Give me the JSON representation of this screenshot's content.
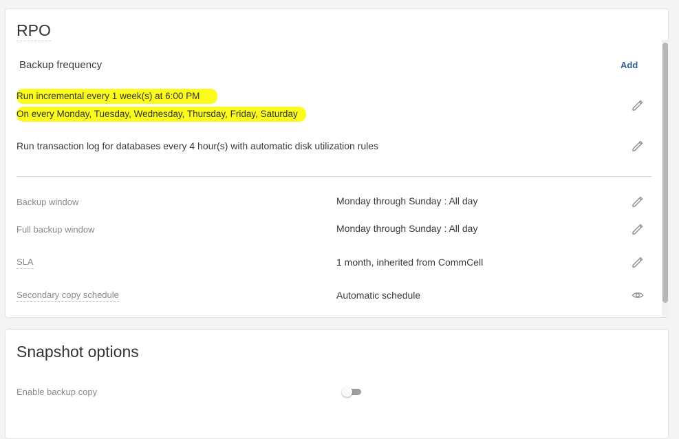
{
  "rpo": {
    "title": "RPO",
    "backup_frequency_label": "Backup frequency",
    "add_label": "Add",
    "schedule_line1": "Run incremental every 1 week(s) at 6:00 PM",
    "schedule_line2": "On every Monday, Tuesday, Wednesday, Thursday, Friday, Saturday",
    "transaction_log": "Run transaction log for databases every 4 hour(s) with automatic disk utilization rules",
    "rows": [
      {
        "label": "Backup window",
        "value": "Monday through Sunday : All day",
        "action_icon": "pencil-icon"
      },
      {
        "label": "Full backup window",
        "value": "Monday through Sunday : All day",
        "action_icon": "pencil-icon"
      },
      {
        "label": "SLA",
        "value": "1 month, inherited from CommCell",
        "action_icon": "pencil-icon"
      },
      {
        "label": "Secondary copy schedule",
        "value": "Automatic schedule",
        "action_icon": "eye-icon"
      }
    ],
    "highlight_color": "#fbfb1e",
    "link_color": "#2f5f93"
  },
  "snapshot": {
    "title": "Snapshot options",
    "enable_backup_copy_label": "Enable backup copy",
    "enable_backup_copy_on": false
  }
}
